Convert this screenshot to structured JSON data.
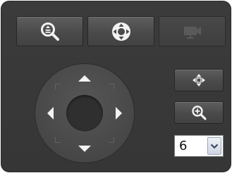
{
  "toolbar": {
    "zoom_button_icon": "zoom-center-icon",
    "focus_button_icon": "ptz-direction-icon",
    "camera_button_icon": "camera-icon",
    "camera_button_disabled": true
  },
  "ptz": {
    "directions": [
      "up",
      "down",
      "left",
      "right"
    ]
  },
  "side": {
    "center_button_icon": "recenter-icon",
    "zoom_in_button_icon": "zoom-in-icon"
  },
  "speed_select": {
    "value": "6"
  },
  "colors": {
    "panel": "#3b3b3b",
    "button": "#4e4e4e",
    "icon": "#f2f2f2",
    "disabled_icon": "#5a5a5a"
  }
}
